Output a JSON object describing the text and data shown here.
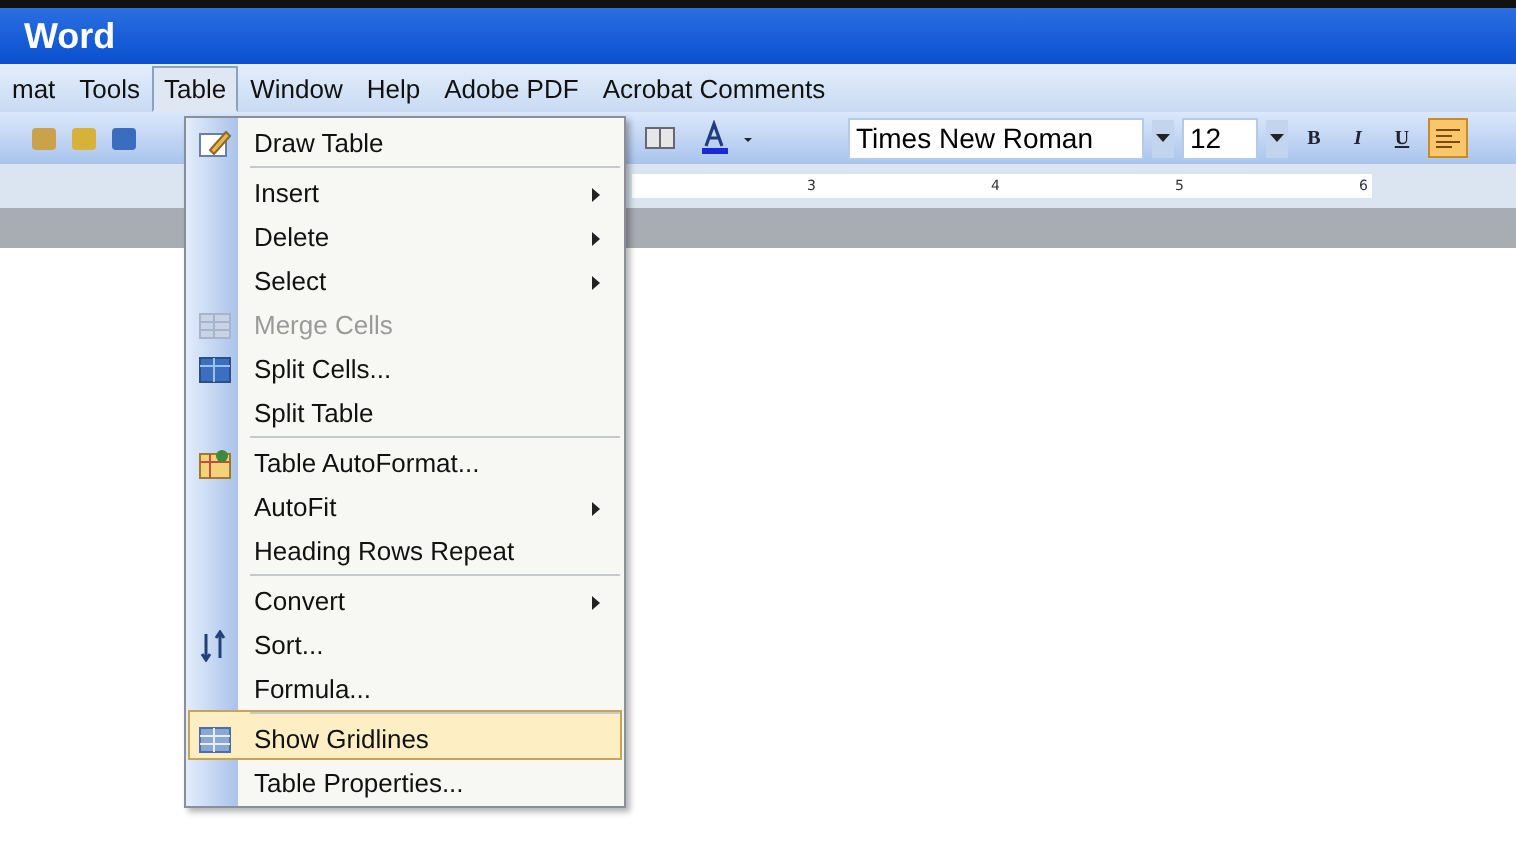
{
  "window": {
    "title": "Word"
  },
  "menubar": [
    {
      "label": "mat",
      "selected": false
    },
    {
      "label": "Tools",
      "selected": false
    },
    {
      "label": "Table",
      "selected": true
    },
    {
      "label": "Window",
      "selected": false
    },
    {
      "label": "Help",
      "selected": false
    },
    {
      "label": "Adobe PDF",
      "selected": false
    },
    {
      "label": "Acrobat Comments",
      "selected": false
    }
  ],
  "toolbar": {
    "font": "Times New Roman",
    "size": "12",
    "format_buttons": [
      {
        "label": "B",
        "selected": false
      },
      {
        "label": "I",
        "selected": false
      },
      {
        "label": "U",
        "selected": false
      }
    ],
    "align_left_selected": true
  },
  "ruler": [
    "3",
    "4",
    "5",
    "6"
  ],
  "menu": [
    {
      "label": "Draw Table",
      "submenu": false,
      "disabled": false,
      "selected": false,
      "separator_before": false
    },
    {
      "label": "Insert",
      "submenu": true,
      "disabled": false,
      "selected": false,
      "separator_before": true
    },
    {
      "label": "Delete",
      "submenu": true,
      "disabled": false,
      "selected": false,
      "separator_before": false
    },
    {
      "label": "Select",
      "submenu": true,
      "disabled": false,
      "selected": false,
      "separator_before": false
    },
    {
      "label": "Merge Cells",
      "submenu": false,
      "disabled": true,
      "selected": false,
      "separator_before": false
    },
    {
      "label": "Split Cells...",
      "submenu": false,
      "disabled": false,
      "selected": false,
      "separator_before": false
    },
    {
      "label": "Split Table",
      "submenu": false,
      "disabled": false,
      "selected": false,
      "separator_before": false
    },
    {
      "label": "Table AutoFormat...",
      "submenu": false,
      "disabled": false,
      "selected": false,
      "separator_before": true
    },
    {
      "label": "AutoFit",
      "submenu": true,
      "disabled": false,
      "selected": false,
      "separator_before": false
    },
    {
      "label": "Heading Rows Repeat",
      "submenu": false,
      "disabled": false,
      "selected": false,
      "separator_before": false
    },
    {
      "label": "Convert",
      "submenu": true,
      "disabled": false,
      "selected": false,
      "separator_before": true
    },
    {
      "label": "Sort...",
      "submenu": false,
      "disabled": false,
      "selected": false,
      "separator_before": false
    },
    {
      "label": "Formula...",
      "submenu": false,
      "disabled": false,
      "selected": false,
      "separator_before": false
    },
    {
      "label": "Show Gridlines",
      "submenu": false,
      "disabled": false,
      "selected": true,
      "separator_before": true
    },
    {
      "label": "Table Properties...",
      "submenu": false,
      "disabled": false,
      "selected": false,
      "separator_before": false
    }
  ]
}
